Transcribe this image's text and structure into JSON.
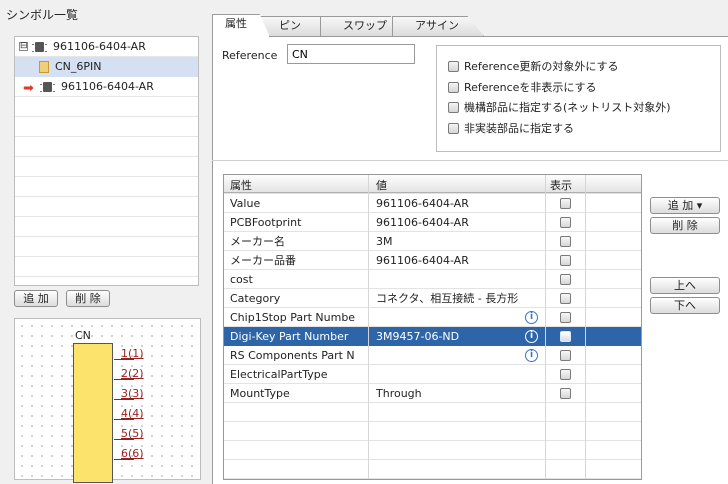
{
  "left_panel": {
    "title": "シンボル一覧",
    "tree": [
      {
        "label": "961106-6404-AR",
        "expander": "⊟"
      },
      {
        "label": "CN_6PIN"
      },
      {
        "label": "961106-6404-AR"
      }
    ],
    "add_button": "追 加",
    "delete_button": "削 除"
  },
  "symbol_preview": {
    "reference": "CN",
    "pins": [
      "1(1)",
      "2(2)",
      "3(3)",
      "4(4)",
      "5(5)",
      "6(6)"
    ]
  },
  "tabs": [
    "属性",
    "ピン",
    "スワップ",
    "アサイン"
  ],
  "reference": {
    "label": "Reference",
    "value": "CN"
  },
  "options": [
    "Reference更新の対象外にする",
    "Referenceを非表示にする",
    "機構部品に指定する(ネットリスト対象外)",
    "非実装部品に指定する"
  ],
  "table": {
    "headers": {
      "name": "属性",
      "value": "値",
      "show": "表示"
    },
    "rows": [
      {
        "name": "Value",
        "value": "961106-6404-AR"
      },
      {
        "name": "PCBFootprint",
        "value": "961106-6404-AR"
      },
      {
        "name": "メーカー名",
        "value": "3M"
      },
      {
        "name": "メーカー品番",
        "value": "961106-6404-AR"
      },
      {
        "name": "cost",
        "value": ""
      },
      {
        "name": "Category",
        "value": "コネクタ、相互接続 - 長方形"
      },
      {
        "name": "Chip1Stop Part Numbe",
        "value": "",
        "info": "i"
      },
      {
        "name": "Digi-Key Part Number",
        "value": "3M9457-06-ND",
        "info": "i"
      },
      {
        "name": "RS Components Part N",
        "value": "",
        "info": "i"
      },
      {
        "name": "ElectricalPartType",
        "value": ""
      },
      {
        "name": "MountType",
        "value": "Through"
      }
    ]
  },
  "right_buttons": {
    "add": "追 加 ▾",
    "delete": "削 除",
    "up": "上へ",
    "down": "下へ"
  },
  "colors": {
    "selection": "#2d65a8",
    "symbol_fill": "#fbe36c",
    "pin": "#9c1e1e",
    "arrow": "#e23a2a"
  }
}
